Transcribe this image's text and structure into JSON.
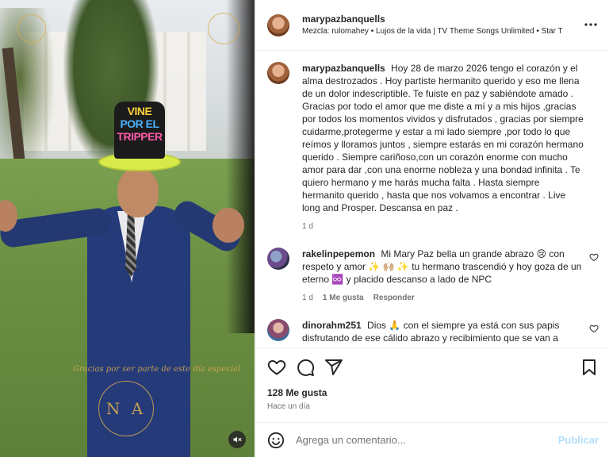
{
  "media": {
    "hat_lines": [
      "VINE",
      "POR EL",
      "TRIPPER"
    ],
    "watermark": "Gracias por ser parte de este día especial",
    "monogram": "N A",
    "mute_icon": "speaker-muted-icon"
  },
  "header": {
    "username": "marypazbanquells",
    "music": "Mezcla: rulomahey • Lujos de la vida | TV Theme Songs Unlimited • Star T",
    "more_icon": "more-horizontal-icon"
  },
  "caption": {
    "username": "marypazbanquells",
    "text": "Hoy 28 de marzo 2026 tengo el corazón y el alma destrozados . Hoy partiste hermanito querido y eso me llena de un dolor indescriptible. Te fuiste en paz y sabiéndote amado . Gracias por todo el amor que me diste a mí y a mis hijos ,gracias por todos los momentos vividos y disfrutados , gracias por siempre cuidarme,protegerme y estar a mi lado siempre ,por todo lo que reímos y lloramos juntos , siempre estarás en mi corazón hermano querido . Siempre cariñoso,con un corazón enorme con mucho amor para dar ,con una enorme nobleza y una bondad infinita . Te quiero hermano y me harás mucha falta . Hasta siempre hermanito querido , hasta que nos volvamos a encontrar . Live long and Prosper. Descansa en paz .",
    "time": "1 d"
  },
  "comments": [
    {
      "username": "rakelinpepemon",
      "text": "Mi Mary Paz bella un grande abrazo 😢 con respeto y amor ✨ 🙌🏼 ✨ tu hermano trascendió y hoy goza de un eterno ♾️ y placido descanso a lado de NPC",
      "time": "1 d",
      "likes": "1 Me gusta",
      "reply": "Responder"
    },
    {
      "username": "dinorahm251",
      "text": "Dios 🙏 con el siempre ya está con sus papis disfrutando de ese cálido abrazo y recibimiento que se van a",
      "time": "",
      "likes": "",
      "reply": ""
    }
  ],
  "actions": {
    "likes": "128 Me gusta",
    "time": "Hace un día",
    "icons": [
      "heart-icon",
      "comment-icon",
      "share-icon",
      "bookmark-icon"
    ]
  },
  "add_comment": {
    "placeholder": "Agrega un comentario...",
    "publish": "Publicar",
    "emoji_icon": "emoji-icon"
  },
  "colors": {
    "publish": "#b2dffc",
    "hat_brim": "#d8ea4a",
    "suit": "#253a78"
  }
}
